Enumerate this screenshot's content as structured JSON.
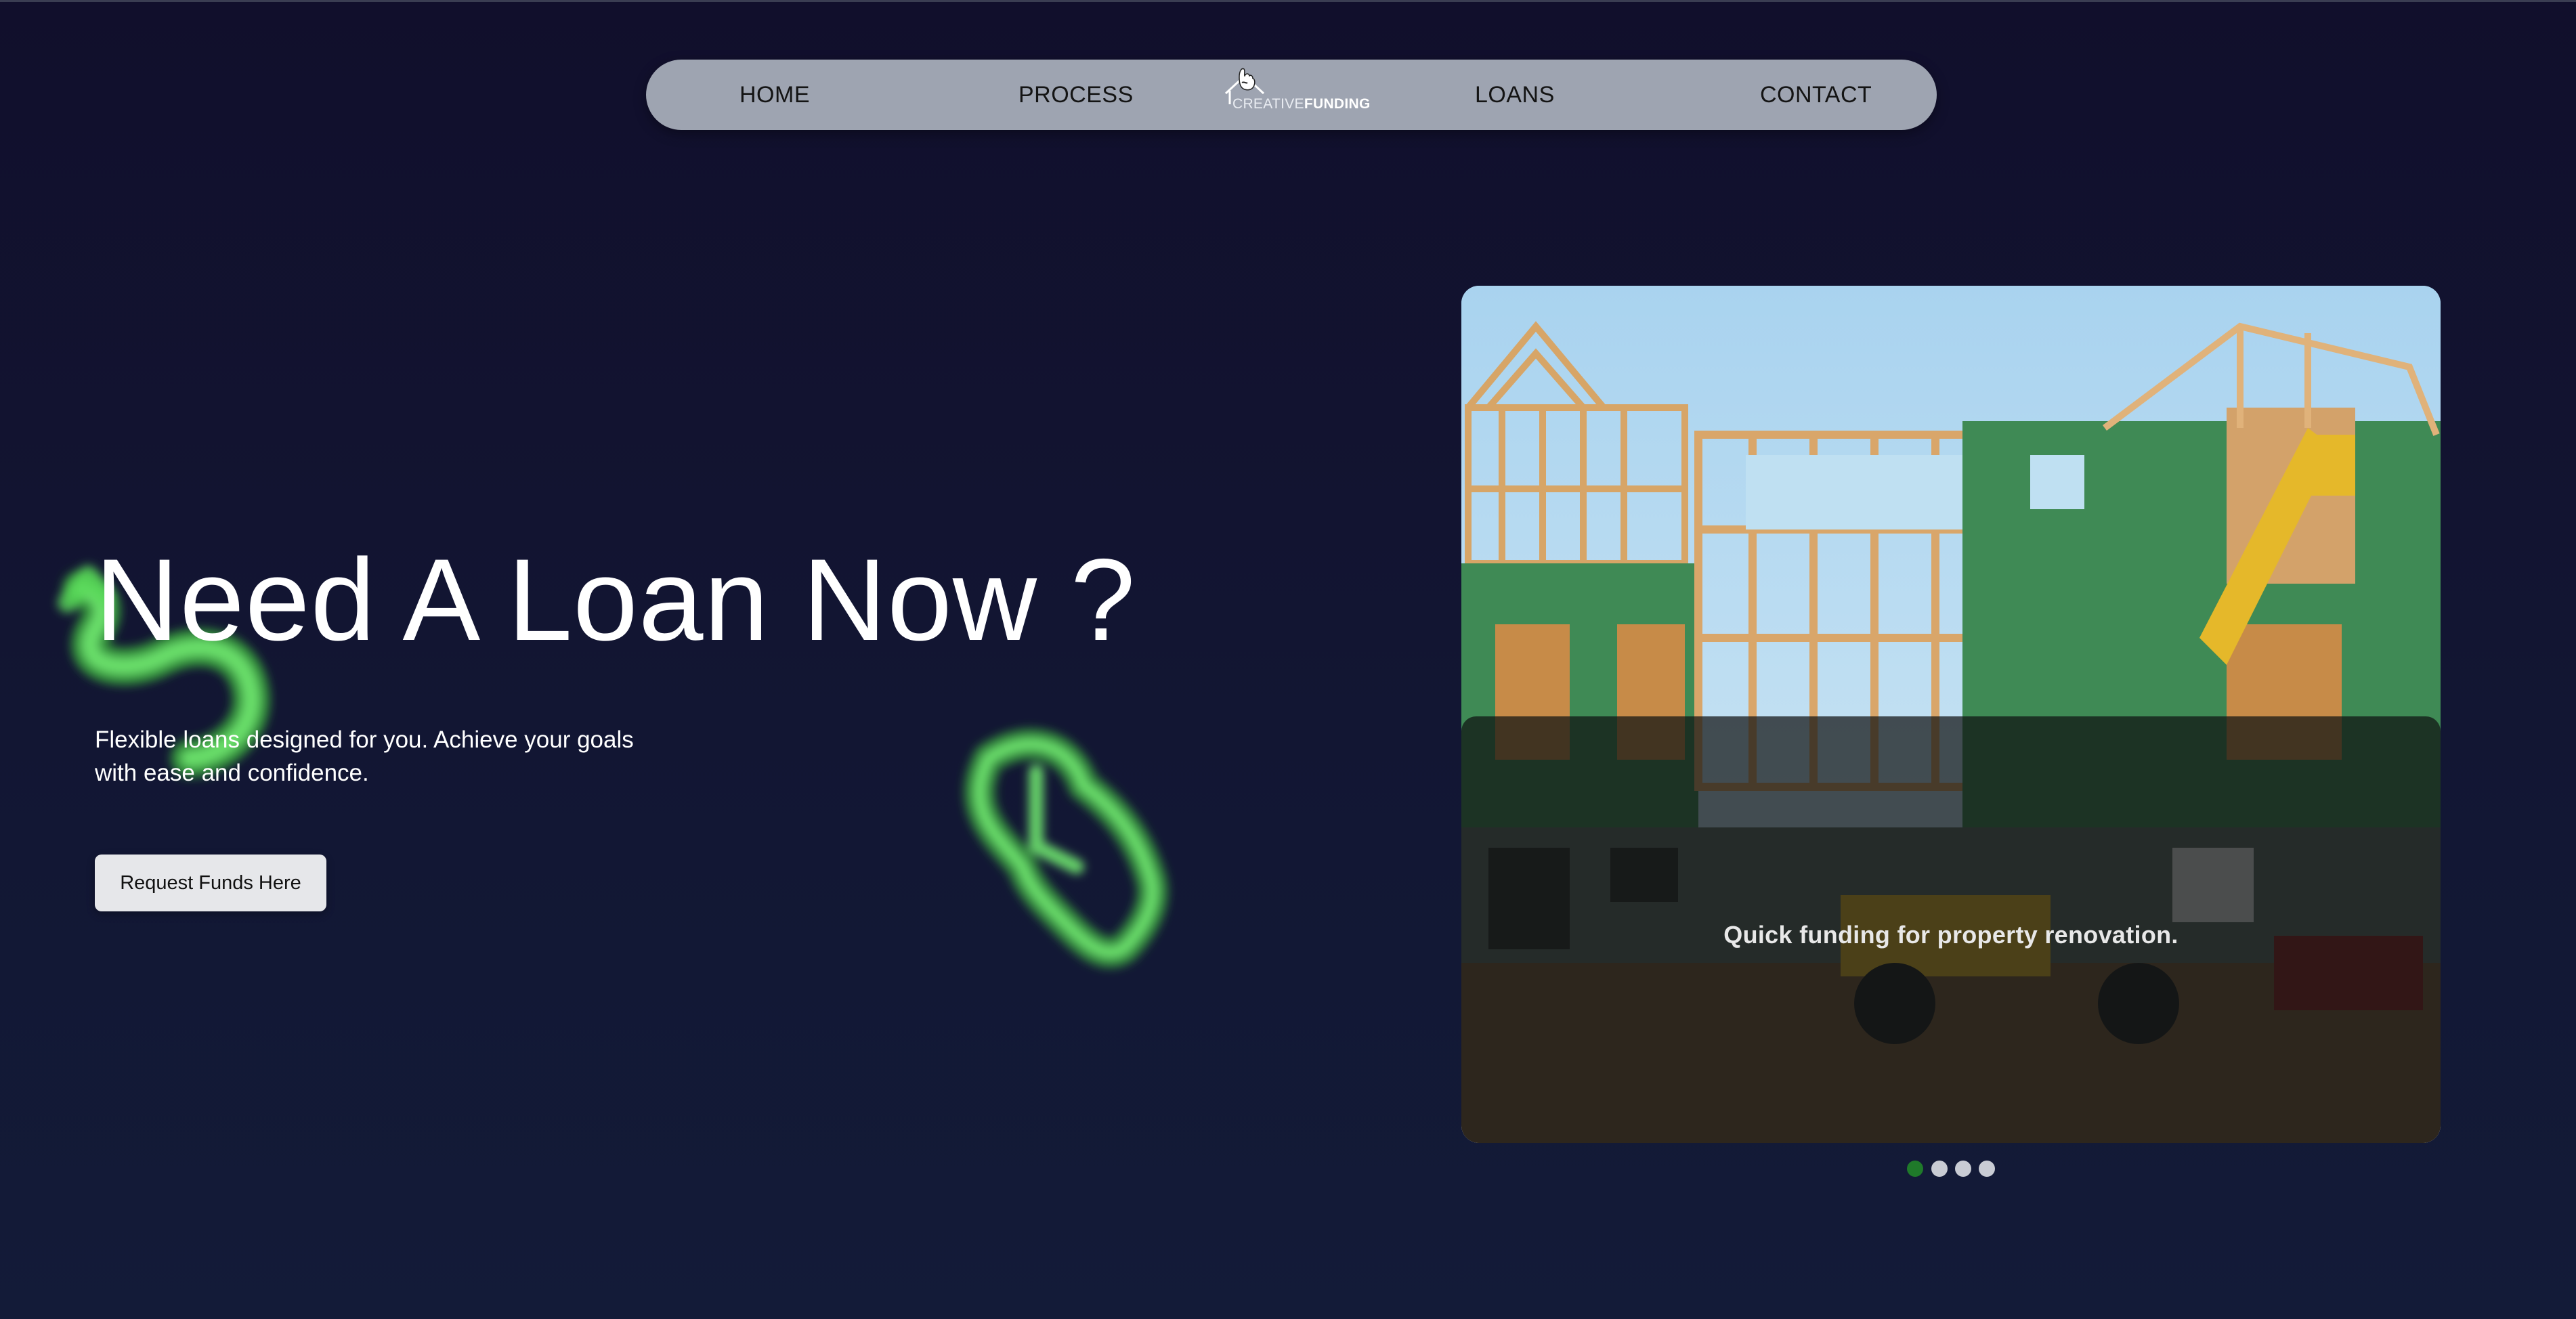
{
  "nav": {
    "home": "HOME",
    "process": "PROCESS",
    "loans": "LOANS",
    "contact": "CONTACT",
    "logo_part1": "CREATIVE",
    "logo_part2": "FUNDING"
  },
  "hero": {
    "headline": "Need A Loan Now ?",
    "subtitle": "Flexible loans designed for you. Achieve your goals with ease and confidence.",
    "cta_label": "Request Funds Here"
  },
  "slider": {
    "caption": "Quick funding for property renovation.",
    "slide_count": 4,
    "active_index": 0
  },
  "icons": {
    "logo": "house-hand-icon",
    "decor_left": "dollar-icon",
    "decor_right": "clock-icon"
  },
  "colors": {
    "background": "#110f2c",
    "nav_bg": "#9ea4b1",
    "accent_green": "#4fd44f",
    "active_dot": "#1f7a2a",
    "inactive_dot": "#c9ccd4"
  }
}
